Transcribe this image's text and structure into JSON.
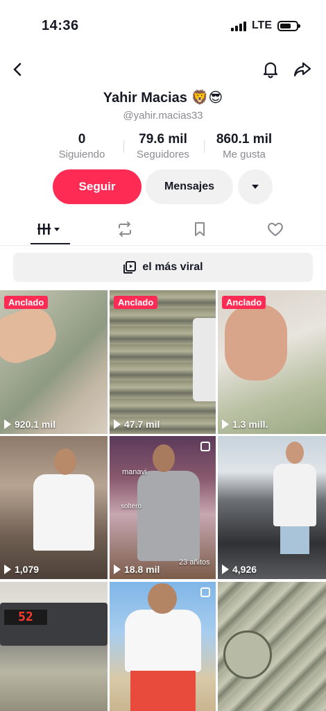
{
  "status_bar": {
    "time": "14:36",
    "network": "LTE"
  },
  "profile": {
    "name": "Yahir Macias 🦁😎",
    "handle": "@yahir.macias33"
  },
  "stats": [
    {
      "value": "0",
      "label": "Siguiendo"
    },
    {
      "value": "79.6 mil",
      "label": "Seguidores"
    },
    {
      "value": "860.1 mil",
      "label": "Me gusta"
    }
  ],
  "actions": {
    "follow": "Seguir",
    "message": "Mensajes"
  },
  "viral_banner": "el más viral",
  "videos": [
    {
      "pinned": "Anclado",
      "views": "920.1 mil"
    },
    {
      "pinned": "Anclado",
      "views": "47.7 mil"
    },
    {
      "pinned": "Anclado",
      "views": "1.3 mill."
    },
    {
      "views": "1,079",
      "overlay": ""
    },
    {
      "views": "18.8 mil",
      "overlay_top": "manavi",
      "overlay_mid": "soltero",
      "overlay_bottom": "23 añitos"
    },
    {
      "views": "4,926"
    },
    {
      "counter": "52"
    },
    {},
    {}
  ],
  "colors": {
    "accent": "#fe2c55",
    "muted": "#8a8b91"
  },
  "icons": {
    "back": "chevron-left-icon",
    "bell": "bell-icon",
    "share": "share-arrow-icon",
    "videos_tab": "grid-bars-icon",
    "repost_tab": "repost-icon",
    "favorites_tab": "bookmark-icon",
    "liked_tab": "heart-icon",
    "banner": "play-collection-icon"
  }
}
